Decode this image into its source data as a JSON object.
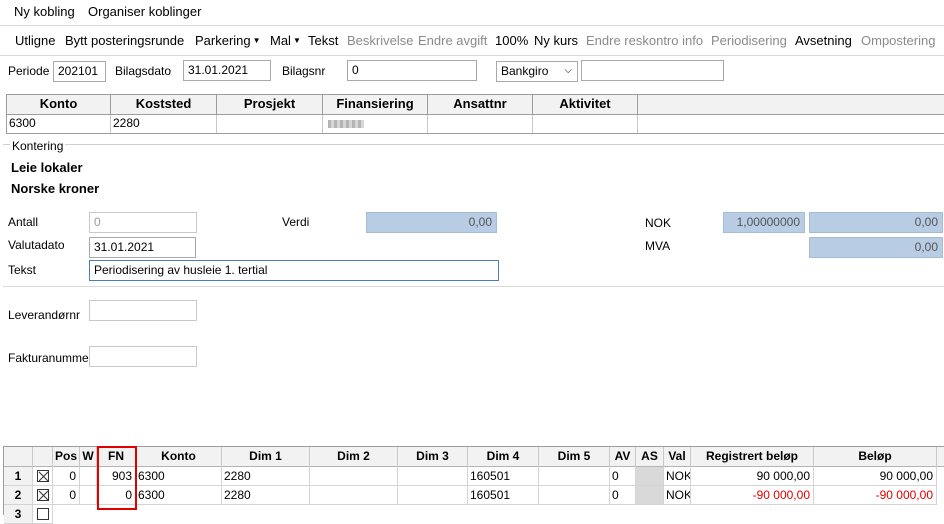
{
  "menu": {
    "new_link": "Ny kobling",
    "organize_links": "Organiser koblinger"
  },
  "toolbar": {
    "items": [
      "Utligne",
      "Bytt posteringsrunde",
      "Parkering",
      "Mal",
      "Tekst",
      "Beskrivelse",
      "Endre avgift",
      "100%",
      "Ny kurs",
      "Endre reskontro info",
      "Periodisering",
      "Avsetning",
      "Ompostering"
    ]
  },
  "header": {
    "periode_label": "Periode",
    "periode_value": "202101",
    "bilagsdato_label": "Bilagsdato",
    "bilagsdato_value": "31.01.2021",
    "bilagsnr_label": "Bilagsnr",
    "bilagsnr_value": "0",
    "type_value": "Bankgiro",
    "extra_value": ""
  },
  "dims": {
    "headers": [
      "Konto",
      "Koststed",
      "Prosjekt",
      "Finansiering",
      "Ansattnr",
      "Aktivitet"
    ],
    "values": [
      "6300",
      "2280",
      "",
      "",
      "",
      ""
    ]
  },
  "kontering": {
    "group_label": "Kontering",
    "account_name": "Leie lokaler",
    "currency_name": "Norske kroner",
    "antall_label": "Antall",
    "antall_value": "0",
    "verdi_label": "Verdi",
    "verdi_value": "0,00",
    "nok_label": "NOK",
    "nok_rate": "1,00000000",
    "nok_value": "0,00",
    "valutadato_label": "Valutadato",
    "valutadato_value": "31.01.2021",
    "mva_label": "MVA",
    "mva_value": "0,00",
    "tekst_label": "Tekst",
    "tekst_value": "Periodisering av husleie 1. tertial",
    "leverandor_label": "Leverandørnr",
    "faktura_label": "Fakturanummer"
  },
  "grid": {
    "headers": [
      "Pos",
      "W",
      "FN",
      "Konto",
      "Dim 1",
      "Dim 2",
      "Dim 3",
      "Dim 4",
      "Dim 5",
      "AV",
      "AS",
      "Val",
      "Registrert beløp",
      "Beløp"
    ],
    "rows": [
      {
        "num": "1",
        "pos": "0",
        "fn": "903",
        "konto": "6300",
        "dim1": "2280",
        "dim4": "160501",
        "av": "0",
        "val": "NOK",
        "reg": "90 000,00",
        "bel": "90 000,00",
        "neg": false
      },
      {
        "num": "2",
        "pos": "0",
        "fn": "0",
        "konto": "6300",
        "dim1": "2280",
        "dim4": "160501",
        "av": "0",
        "val": "NOK",
        "reg": "-90 000,00",
        "bel": "-90 000,00",
        "neg": true
      },
      {
        "num": "3"
      }
    ]
  },
  "colors": {
    "field_blue": "#b8cce4",
    "negative": "#e00000",
    "highlight": "#e00000"
  }
}
